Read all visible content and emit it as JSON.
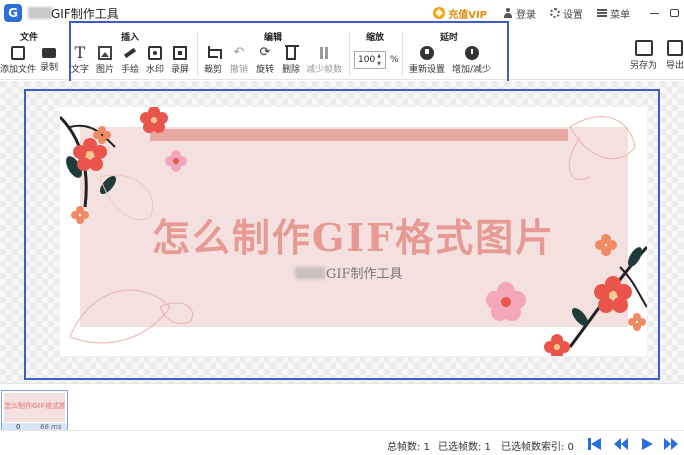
{
  "app": {
    "title": "GIF制作工具",
    "logo_letter": "G"
  },
  "titlebar": {
    "vip_label": "充值VIP",
    "login_label": "登录",
    "settings_label": "设置",
    "menu_label": "菜单"
  },
  "toolbar": {
    "groups": {
      "file": "文件",
      "insert": "插入",
      "edit": "编辑",
      "zoom": "缩放",
      "delay": "延时"
    },
    "file": {
      "add_file": "添加文件",
      "record": "录制"
    },
    "insert": {
      "text": "文字",
      "image": "图片",
      "draw": "手绘",
      "watermark": "水印",
      "screen_record": "录屏"
    },
    "edit": {
      "crop": "裁剪",
      "undo": "撤销",
      "rotate": "旋转",
      "delete": "删除",
      "reduce_frames": "减少帧数"
    },
    "zoom": {
      "value": "100",
      "unit": "%"
    },
    "delay": {
      "reset": "重新设置",
      "adjust": "增加/减少"
    },
    "save_as": "另存为",
    "export": "导出"
  },
  "canvas": {
    "headline": "怎么制作GIF格式图片",
    "subtitle": "GIF制作工具"
  },
  "frames": [
    {
      "index": "0",
      "duration": "66 ms",
      "thumb_text": "怎么制作GIF格式图片"
    }
  ],
  "status": {
    "total_frames": "总帧数: 1",
    "selected_frames": "已选帧数: 1",
    "selected_index": "已选帧数索引: 0"
  },
  "colors": {
    "accent": "#2b6fd8",
    "highlight_border": "#3b5fc4",
    "headline": "#e79a93",
    "bar": "#e9a9a2",
    "background_pink": "#f4e0df",
    "vip": "#e48c0e"
  }
}
